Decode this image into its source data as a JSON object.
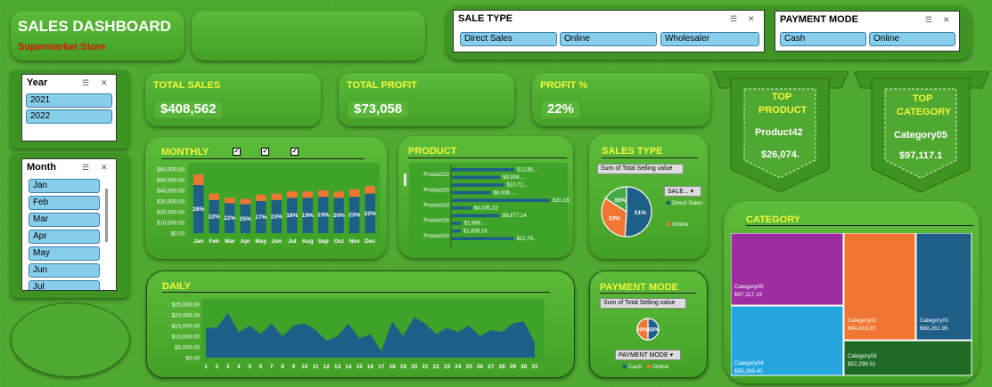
{
  "header": {
    "title": "SALES DASHBOARD",
    "subtitle": "Supermarket Store"
  },
  "sale_type": {
    "title": "SALE TYPE",
    "items": [
      "Direct Sales",
      "Online",
      "Wholesaler"
    ]
  },
  "payment_mode_slicer": {
    "title": "PAYMENT MODE",
    "items": [
      "Cash",
      "Online"
    ]
  },
  "year_slicer": {
    "title": "Year",
    "items": [
      "2021",
      "2022"
    ]
  },
  "month_slicer": {
    "title": "Month",
    "items": [
      "Jan",
      "Feb",
      "Mar",
      "Apr",
      "May",
      "Jun",
      "Jul"
    ]
  },
  "kpis": {
    "total_sales_label": "TOTAL SALES",
    "total_sales": "$408,562",
    "total_profit_label": "TOTAL PROFIT",
    "total_profit": "$73,058",
    "profit_pct_label": "PROFIT %",
    "profit_pct": "22%"
  },
  "top_product": {
    "label_1": "TOP",
    "label_2": "PRODUCT",
    "name": "Product42",
    "value": "$26,074."
  },
  "top_category": {
    "label_1": "TOP",
    "label_2": "CATEGORY",
    "name": "Category05",
    "value": "$97,117.1"
  },
  "titles": {
    "monthly": "MONTHLY",
    "product": "PRODUCT",
    "sales_type": "SALES TYPE",
    "daily": "DAILY",
    "payment_mode": "PAYMENT MODE",
    "category": "CATEGORY"
  },
  "sales_type_chart": {
    "field_button": "Sum of Total Selling value",
    "filter_button": "SALE...",
    "legend": [
      "Direct Sales",
      "Online"
    ]
  },
  "payment_chart": {
    "field_button": "Sum of Total Selling value",
    "filter_button": "PAYMENT MODE",
    "legend": [
      "Cash",
      "Online"
    ]
  },
  "colors": {
    "primary": "#1f5f87",
    "accent": "#ef7733",
    "title_yellow": "#f4f83a",
    "panel_green": "#4fa832"
  },
  "chart_data": [
    {
      "type": "bar",
      "title": "MONTHLY",
      "categories": [
        "Jan",
        "Feb",
        "Mar",
        "Apr",
        "May",
        "Jun",
        "Jul",
        "Aug",
        "Sep",
        "Oct",
        "Nov",
        "Dec"
      ],
      "series": [
        {
          "values": [
            45000,
            31000,
            28000,
            27000,
            30000,
            31000,
            33000,
            33000,
            34000,
            33000,
            34000,
            37000
          ]
        },
        {
          "values": [
            10000,
            6000,
            5000,
            5000,
            6000,
            6000,
            6000,
            6000,
            6000,
            6000,
            7000,
            7000
          ]
        }
      ],
      "labels": [
        "28%",
        "22%",
        "22%",
        "25%",
        "17%",
        "23%",
        "18%",
        "19%",
        "23%",
        "20%",
        "23%",
        "22%"
      ],
      "y_ticks": [
        "$60,000.00",
        "$50,000.00",
        "$40,000.00",
        "$30,000.00",
        "$20,000.00",
        "$10,000.00",
        "$0.00"
      ],
      "ylim": [
        0,
        60000
      ]
    },
    {
      "type": "bar",
      "title": "PRODUCT",
      "categories": [
        "Product22",
        "Product20",
        "Product18",
        "Product16",
        "Product14"
      ],
      "values": [
        12850,
        9909,
        10720,
        8006,
        20160,
        4035.22,
        9877.14,
        1996,
        1839.24,
        12760
      ],
      "value_labels": [
        "$12,85...",
        "$9,909....",
        "$10,72...",
        "$8,006....",
        "$20,160...",
        "$4,035.22",
        "$9,877.14",
        "$1,996....",
        "$1,839.24",
        "$12,76..."
      ]
    },
    {
      "type": "pie",
      "title": "SALES TYPE",
      "categories": [
        "Direct Sales",
        "Online",
        "Wholesaler"
      ],
      "values": [
        51,
        33,
        16
      ],
      "labels": [
        "51%",
        "33%",
        "16%"
      ]
    },
    {
      "type": "area",
      "title": "DAILY",
      "x": [
        1,
        2,
        3,
        4,
        5,
        6,
        7,
        8,
        9,
        10,
        11,
        12,
        13,
        14,
        15,
        16,
        17,
        18,
        19,
        20,
        21,
        22,
        23,
        24,
        25,
        26,
        27,
        28,
        29,
        30,
        31
      ],
      "values": [
        14000,
        14000,
        21000,
        12000,
        15000,
        11000,
        16000,
        10000,
        15000,
        16000,
        13000,
        8000,
        10000,
        16000,
        9000,
        11000,
        3000,
        17000,
        10000,
        19000,
        16000,
        11000,
        14000,
        12000,
        15000,
        10000,
        13000,
        12000,
        16000,
        17000,
        7000
      ],
      "y_ticks": [
        "$25,000.00",
        "$20,000.00",
        "$15,000.00",
        "$10,000.00",
        "$5,000.00",
        "$0.00"
      ],
      "ylim": [
        0,
        25000
      ]
    },
    {
      "type": "pie",
      "title": "PAYMENT MODE",
      "categories": [
        "Cash",
        "Online"
      ],
      "values": [
        50,
        50
      ],
      "labels": [
        "50%",
        "50%"
      ]
    },
    {
      "type": "heatmap",
      "title": "CATEGORY",
      "categories": [
        "Category05",
        "Category02",
        "Category01",
        "Category04",
        "Category03"
      ],
      "values": [
        97117.19,
        94613.87,
        69261.95,
        95269.4,
        52299.51
      ],
      "value_labels": [
        "$97,117.19",
        "$94,613.87",
        "$69,261.95",
        "$95,269.40",
        "$52,299.51"
      ]
    }
  ]
}
